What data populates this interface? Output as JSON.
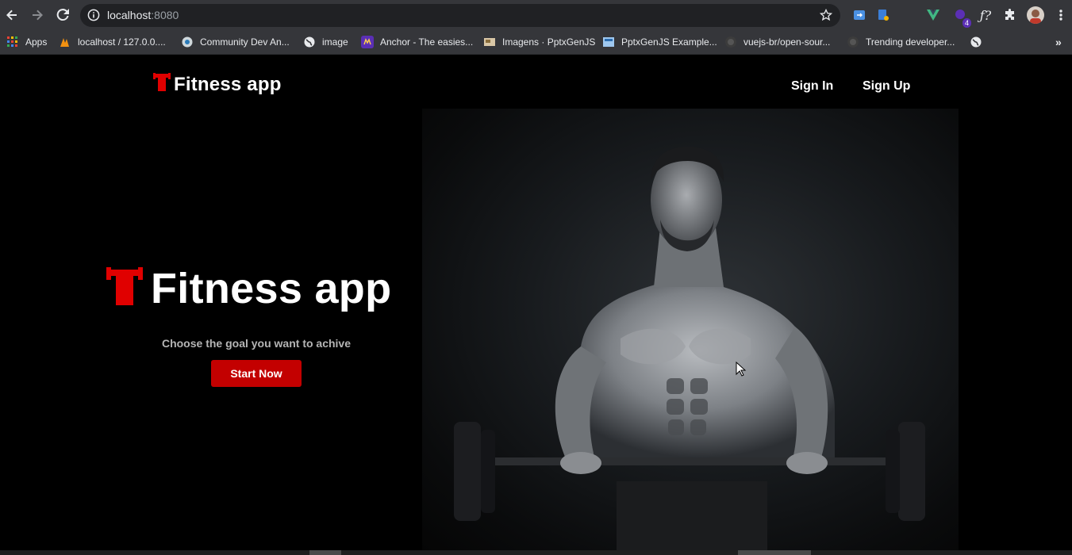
{
  "browser": {
    "url_host": "localhost",
    "url_port": ":8080",
    "extension_badge": "4",
    "bookmarks_overflow": "»",
    "bookmarks": [
      {
        "label": "Apps",
        "icon": "apps-grid-icon"
      },
      {
        "label": "localhost / 127.0.0....",
        "icon": "phpmyadmin-icon"
      },
      {
        "label": "Community Dev An...",
        "icon": "community-icon"
      },
      {
        "label": "image",
        "icon": "globe-icon"
      },
      {
        "label": "Anchor - The easies...",
        "icon": "anchor-icon"
      },
      {
        "label": "Imagens · PptxGenJS",
        "icon": "pptx-icon"
      },
      {
        "label": "PptxGenJS Example...",
        "icon": "pptx-example-icon"
      },
      {
        "label": "vuejs-br/open-sour...",
        "icon": "github-icon"
      },
      {
        "label": "Trending developer...",
        "icon": "github-icon"
      },
      {
        "label": "",
        "icon": "globe-icon"
      }
    ]
  },
  "header": {
    "brand": "Fitness app",
    "nav": {
      "sign_in": "Sign In",
      "sign_up": "Sign Up"
    }
  },
  "hero": {
    "title": "Fitness app",
    "subtitle": "Choose the goal you want to achive",
    "cta_label": "Start Now",
    "image": "bodybuilder-barbell-photo"
  },
  "colors": {
    "accent": "#c30000",
    "logo_red": "#e00000",
    "page_bg": "#000000",
    "chrome_bg": "#35363a"
  }
}
